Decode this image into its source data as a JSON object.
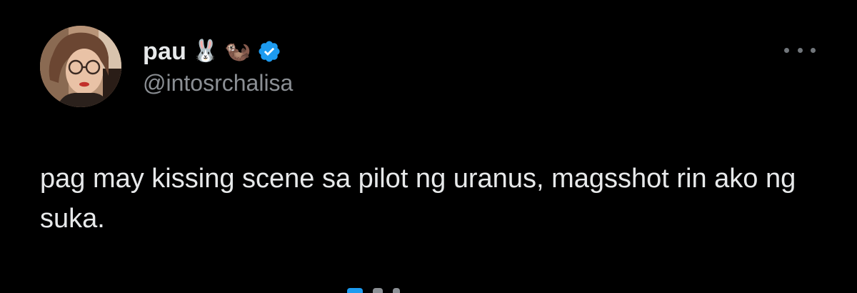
{
  "tweet": {
    "author": {
      "display_name": "pau",
      "handle": "@intosrchalisa",
      "name_emojis": [
        "🐰",
        "🦦"
      ],
      "avatar_icon": "profile-photo",
      "verified_icon": "verified-badge-icon"
    },
    "more_icon": "more-horizontal-icon",
    "text": "pag may kissing scene sa pilot ng uranus, magsshot rin ako ng suka."
  },
  "colors": {
    "background": "#000000",
    "text_primary": "#e7e9ea",
    "text_secondary": "#8b8f94",
    "verified_blue": "#1d9bf0",
    "more_dots": "#71767b"
  }
}
